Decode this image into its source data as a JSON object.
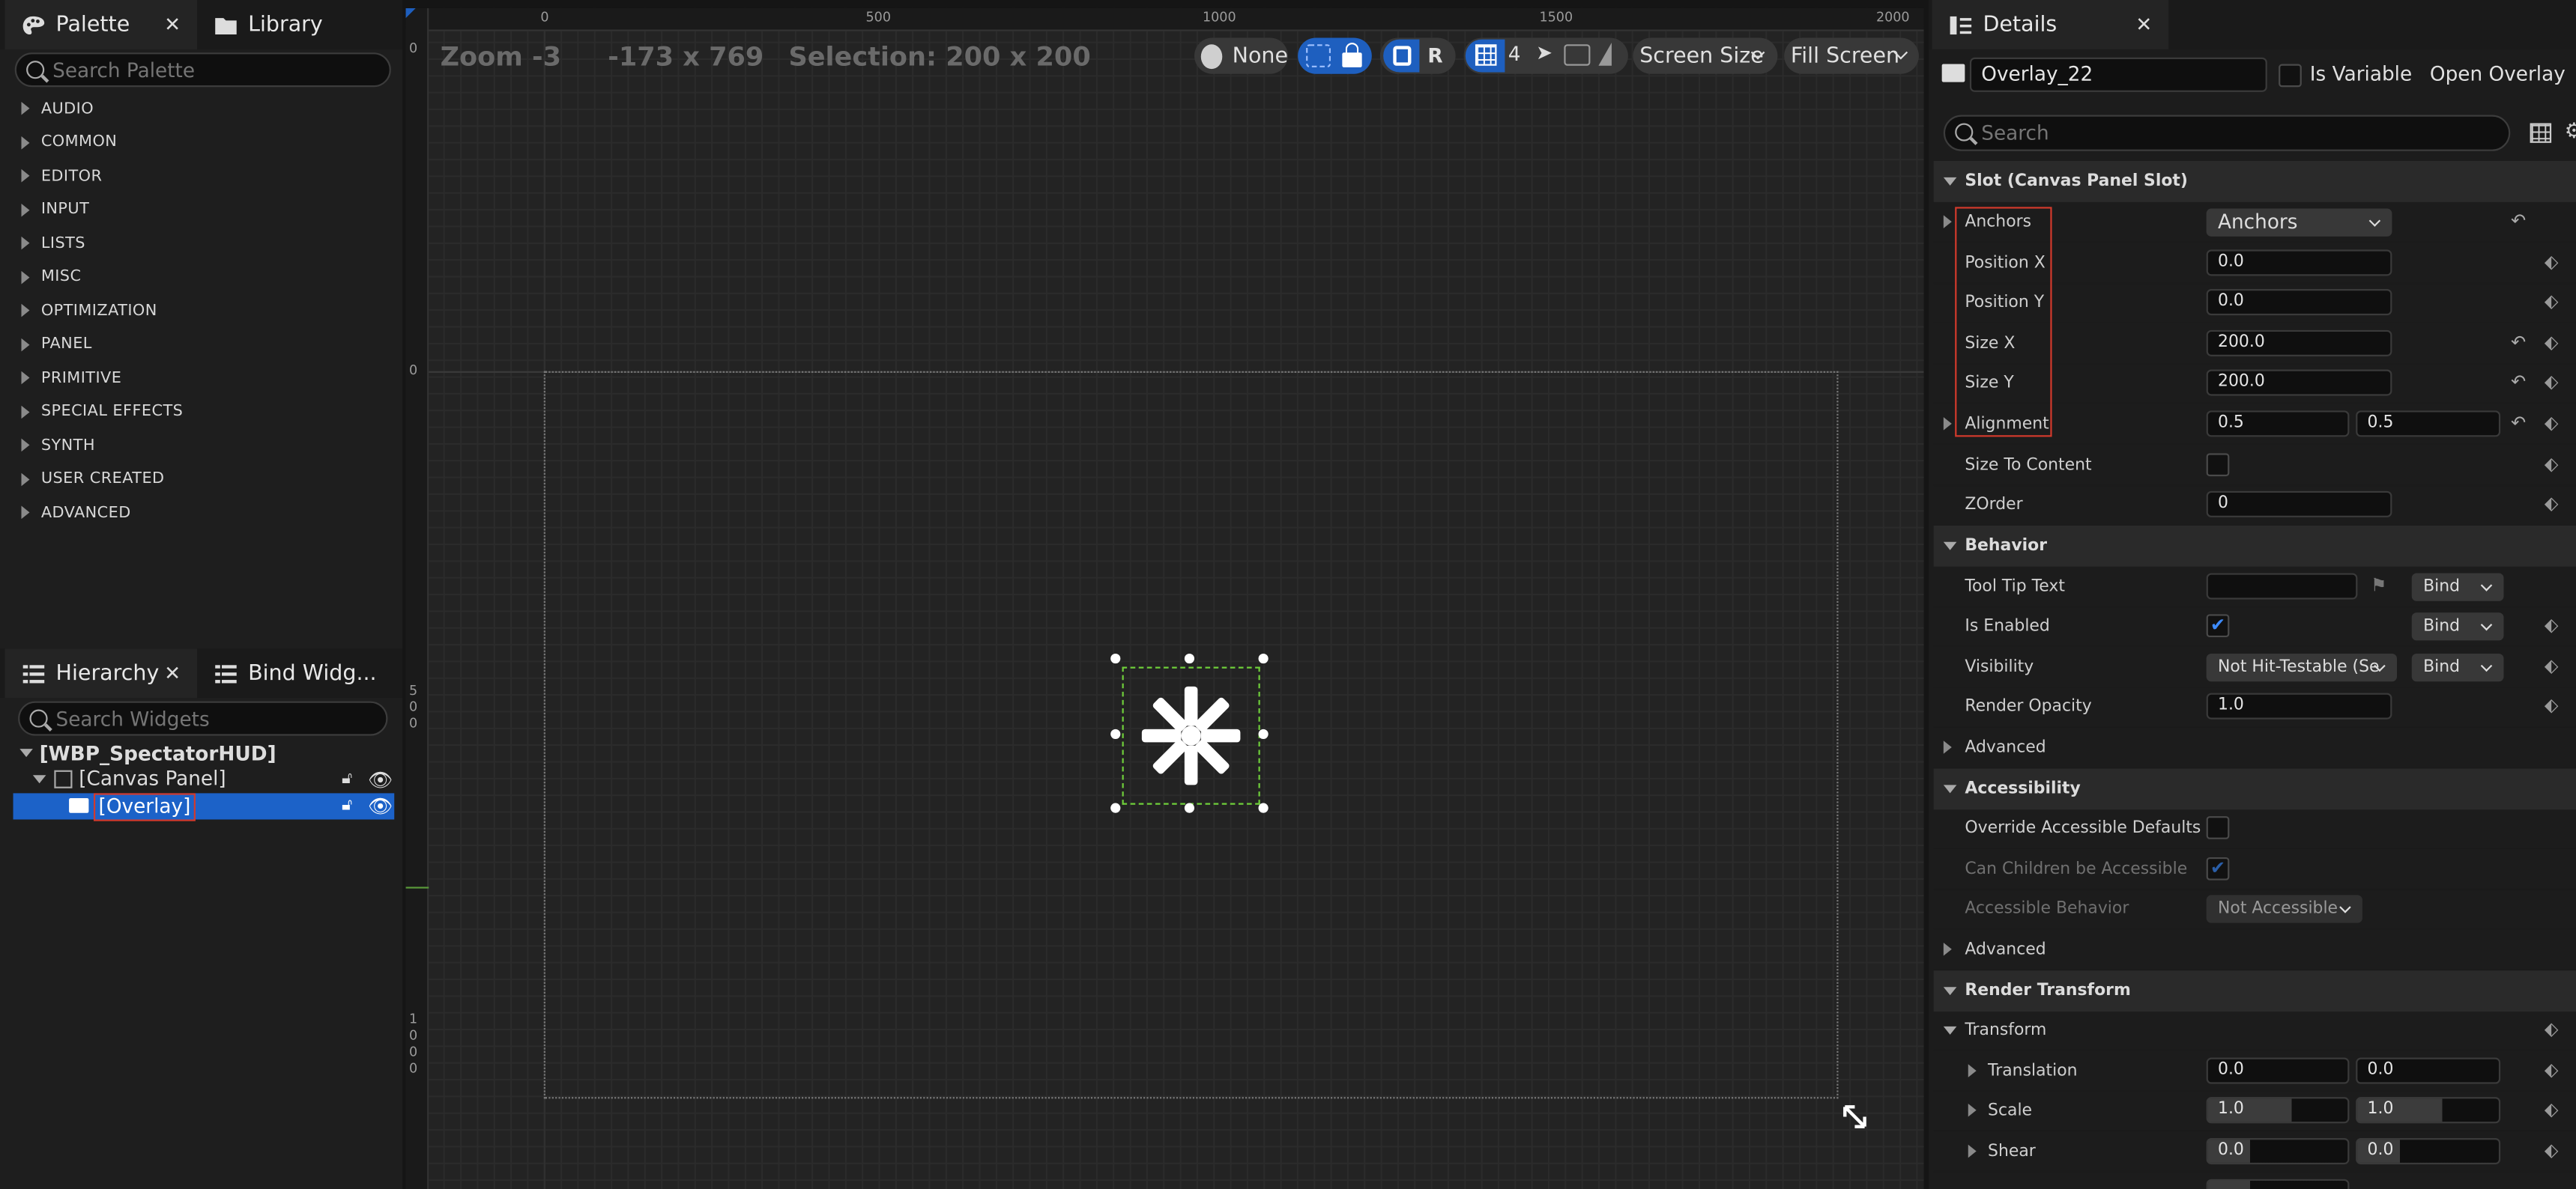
{
  "palette": {
    "tabs": [
      {
        "label": "Palette"
      },
      {
        "label": "Library"
      }
    ],
    "search_placeholder": "Search Palette",
    "categories": [
      "AUDIO",
      "COMMON",
      "EDITOR",
      "INPUT",
      "LISTS",
      "MISC",
      "OPTIMIZATION",
      "PANEL",
      "PRIMITIVE",
      "SPECIAL EFFECTS",
      "SYNTH",
      "USER CREATED",
      "ADVANCED"
    ]
  },
  "hierarchy": {
    "tabs": [
      {
        "label": "Hierarchy"
      },
      {
        "label": "Bind Widg..."
      }
    ],
    "search_placeholder": "Search Widgets",
    "root": "[WBP_SpectatorHUD]",
    "canvas": "[Canvas Panel]",
    "overlay": "[Overlay]"
  },
  "viewport": {
    "zoom": "Zoom -3",
    "size": "-173 x 769",
    "selection": "Selection: 200 x 200",
    "ruler_top": [
      "0",
      "500",
      "1000",
      "1500",
      "2000"
    ],
    "ruler_left": [
      "0",
      "0",
      "5\n0\n0",
      "1\n0\n0\n0"
    ],
    "toolbar": {
      "none": "None",
      "r": "R",
      "grid": "4",
      "screen_size": "Screen Size",
      "fill_screen": "Fill Screen"
    }
  },
  "details": {
    "tab": "Details",
    "widget_name": "Overlay_22",
    "is_variable": "Is Variable",
    "open": "Open Overlay",
    "search_placeholder": "Search",
    "slot_section": "Slot (Canvas Panel Slot)",
    "anchors": {
      "label": "Anchors",
      "value": "Anchors"
    },
    "position_x": {
      "label": "Position X",
      "value": "0.0"
    },
    "position_y": {
      "label": "Position Y",
      "value": "0.0"
    },
    "size_x": {
      "label": "Size X",
      "value": "200.0"
    },
    "size_y": {
      "label": "Size Y",
      "value": "200.0"
    },
    "alignment": {
      "label": "Alignment",
      "x": "0.5",
      "y": "0.5"
    },
    "size_to_content": "Size To Content",
    "zorder": {
      "label": "ZOrder",
      "value": "0"
    },
    "behavior_section": "Behavior",
    "tooltip": {
      "label": "Tool Tip Text",
      "bind": "Bind"
    },
    "is_enabled": {
      "label": "Is Enabled",
      "bind": "Bind"
    },
    "visibility": {
      "label": "Visibility",
      "value": "Not Hit-Testable (Se",
      "bind": "Bind"
    },
    "render_opacity": {
      "label": "Render Opacity",
      "value": "1.0"
    },
    "advanced": "Advanced",
    "accessibility_section": "Accessibility",
    "override_accessible": "Override Accessible Defaults",
    "can_children": "Can Children be Accessible",
    "accessible_behavior": {
      "label": "Accessible Behavior",
      "value": "Not Accessible"
    },
    "advanced2": "Advanced",
    "render_transform_section": "Render Transform",
    "transform": "Transform",
    "translation": {
      "label": "Translation",
      "x": "0.0",
      "y": "0.0"
    },
    "scale": {
      "label": "Scale",
      "x": "1.0",
      "y": "1.0"
    },
    "shear": {
      "label": "Shear",
      "x": "0.0",
      "y": "0.0"
    }
  },
  "colors": {
    "accent": "#1e5fbf",
    "highlight_box": "#d33a2c",
    "selection": "#6fcf3a"
  }
}
